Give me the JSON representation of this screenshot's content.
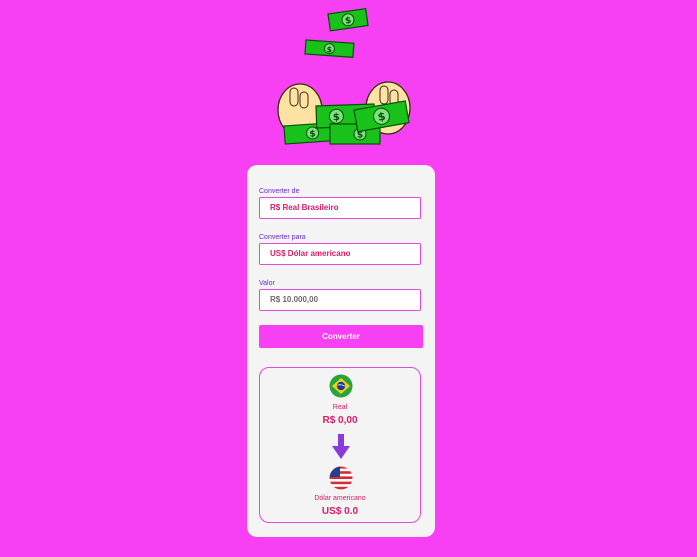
{
  "form": {
    "from_label": "Converter de",
    "from_value": "R$ Real Brasileiro",
    "to_label": "Converter para",
    "to_value": "US$ Dólar americano",
    "amount_label": "Valor",
    "amount_value": "R$ 10.000,00",
    "convert_label": "Converter"
  },
  "result": {
    "from_currency_name": "Real",
    "from_currency_value": "R$ 0,00",
    "to_currency_name": "Dólar americano",
    "to_currency_value": "US$ 0.0"
  },
  "icons": {
    "hero": "money-hands-icon",
    "from_flag": "brazil-flag-icon",
    "to_flag": "usa-flag-icon",
    "arrow": "arrow-down-icon"
  },
  "colors": {
    "background": "#f740f4",
    "accent_text": "#d61d6b",
    "label_text": "#6a2bd9",
    "card": "#f4f4f4"
  }
}
